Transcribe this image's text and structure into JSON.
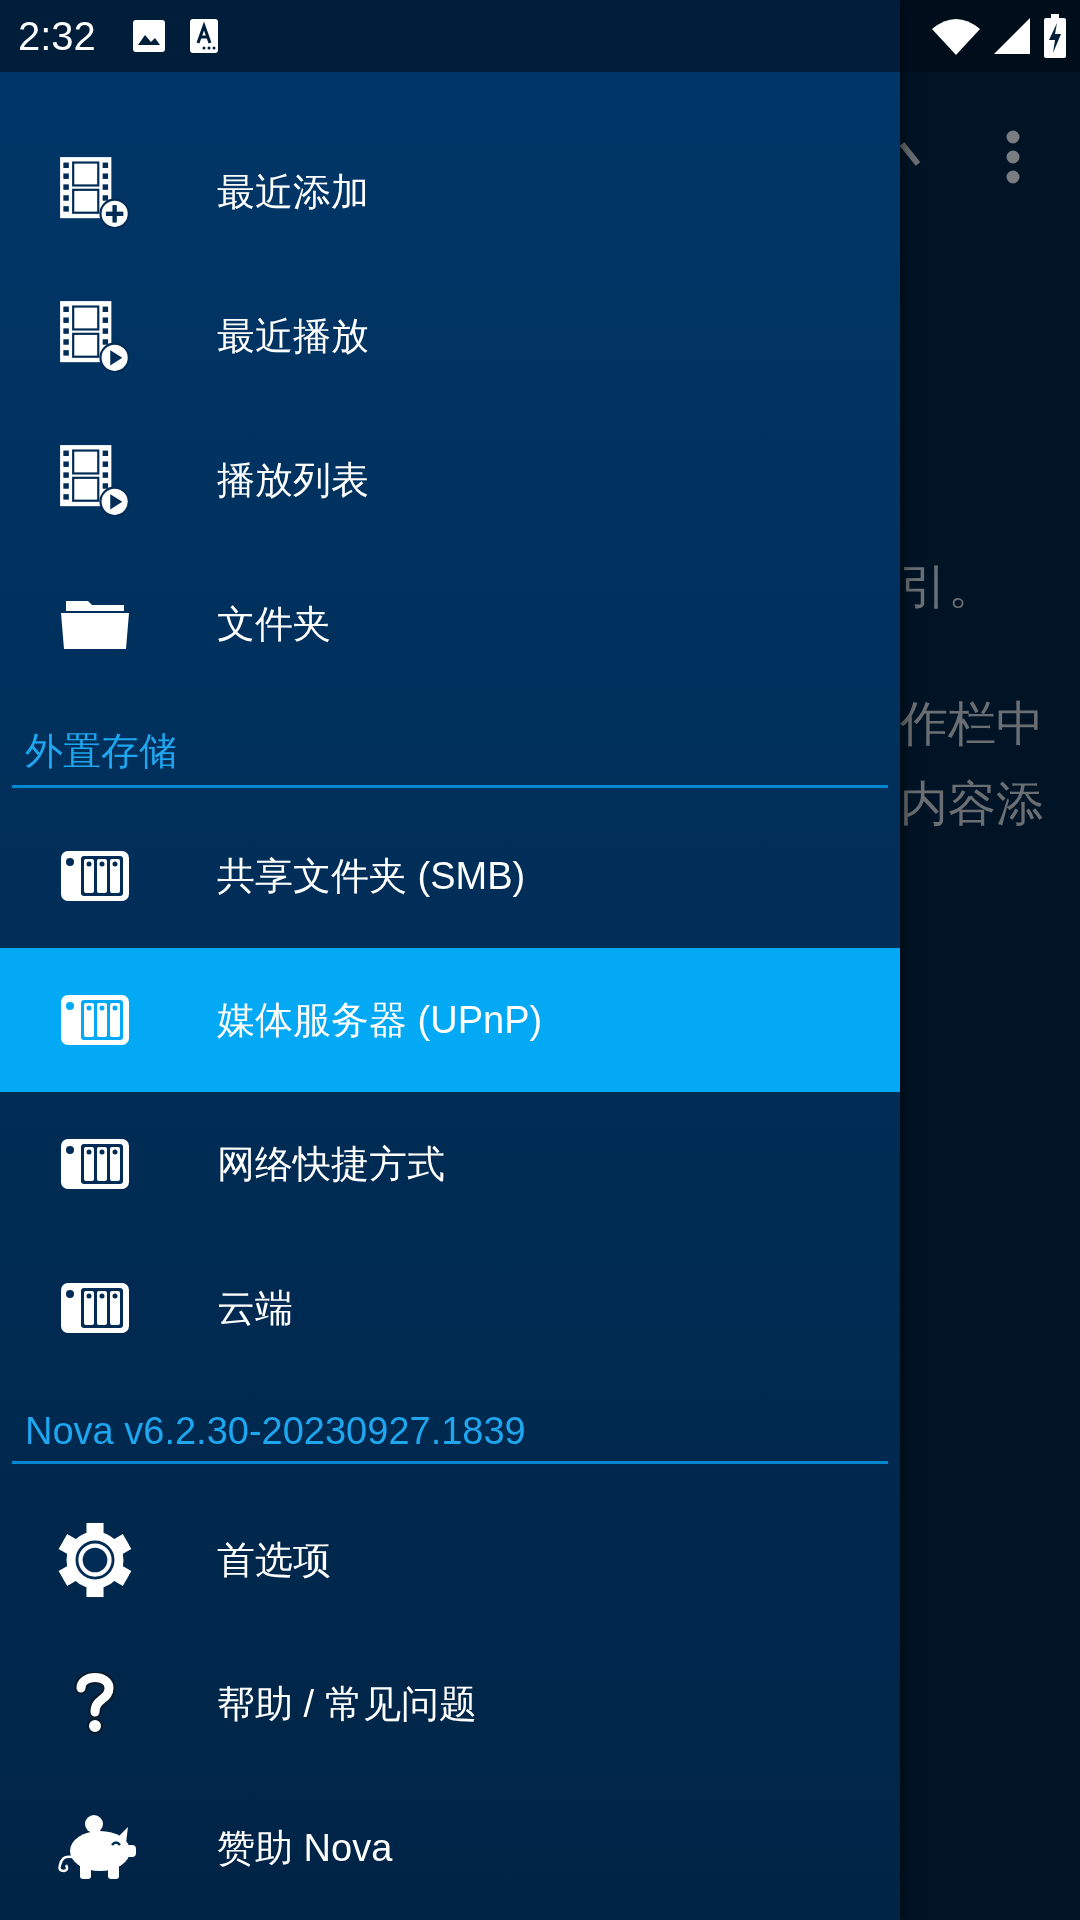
{
  "status_bar": {
    "time": "2:32"
  },
  "background": {
    "texts": [
      "引。",
      "作栏中",
      "内容添"
    ]
  },
  "drawer": {
    "sections": [
      {
        "items": [
          {
            "label": "最近添加",
            "kind": "filmadd",
            "selected": false
          },
          {
            "label": "最近播放",
            "kind": "filmplay",
            "selected": false
          },
          {
            "label": "播放列表",
            "kind": "filmplay",
            "selected": false
          },
          {
            "label": "文件夹",
            "kind": "folder",
            "selected": false
          }
        ]
      },
      {
        "header": "外置存储",
        "items": [
          {
            "label": "共享文件夹 (SMB)",
            "kind": "server",
            "selected": false
          },
          {
            "label": "媒体服务器 (UPnP)",
            "kind": "server",
            "selected": true
          },
          {
            "label": "网络快捷方式",
            "kind": "server",
            "selected": false
          },
          {
            "label": "云端",
            "kind": "server",
            "selected": false
          }
        ]
      },
      {
        "header": "Nova v6.2.30-20230927.1839",
        "items": [
          {
            "label": "首选项",
            "kind": "gear",
            "selected": false
          },
          {
            "label": "帮助 / 常见问题",
            "kind": "help",
            "selected": false
          },
          {
            "label": "赞助 Nova",
            "kind": "piggy",
            "selected": false
          }
        ]
      }
    ]
  }
}
